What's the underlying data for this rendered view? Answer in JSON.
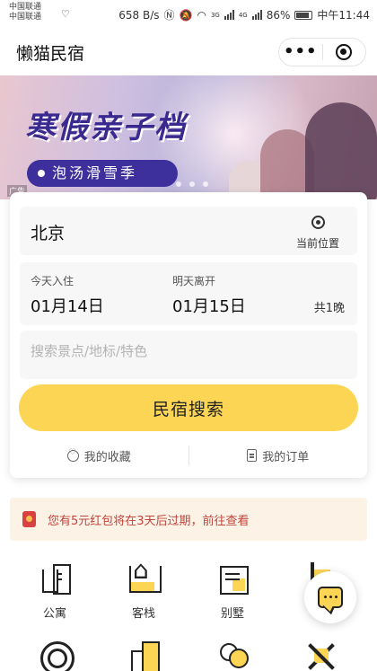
{
  "status_bar": {
    "carrier1": "中国联通",
    "carrier2": "中国联通",
    "speed": "658 B/s",
    "battery": "86%",
    "time": "中午11:44",
    "net_3g": "3G",
    "net_4g": "4G"
  },
  "nav": {
    "title": "懒猫民宿",
    "more_icon": "more-dots-icon",
    "close_icon": "target-circle-icon"
  },
  "banner": {
    "title": "寒假亲子档",
    "subtitle": "泡汤滑雪季",
    "ad_tag": "广告"
  },
  "search": {
    "city": "北京",
    "locate_label": "当前位置",
    "checkin_caption": "今天入住",
    "checkin_date": "01月14日",
    "checkout_caption": "明天离开",
    "checkout_date": "01月15日",
    "nights": "共1晚",
    "placeholder": "搜索景点/地标/特色",
    "button_label": "民宿搜索",
    "favorites_label": "我的收藏",
    "orders_label": "我的订单"
  },
  "notice": {
    "text": "您有5元红包将在3天后过期，前往查看"
  },
  "categories": [
    {
      "label": "公寓",
      "icon": "apartment-icon"
    },
    {
      "label": "客栈",
      "icon": "inn-icon"
    },
    {
      "label": "别墅",
      "icon": "villa-icon"
    },
    {
      "label": "",
      "icon": "category-icon"
    },
    {
      "label": "",
      "icon": "circle-icon"
    },
    {
      "label": "",
      "icon": "building-icon"
    },
    {
      "label": "",
      "icon": "people-icon"
    },
    {
      "label": "",
      "icon": "tools-icon"
    }
  ],
  "colors": {
    "accent": "#fcd555",
    "notice_text": "#c0453d",
    "banner_title": "#3a2a8f"
  }
}
